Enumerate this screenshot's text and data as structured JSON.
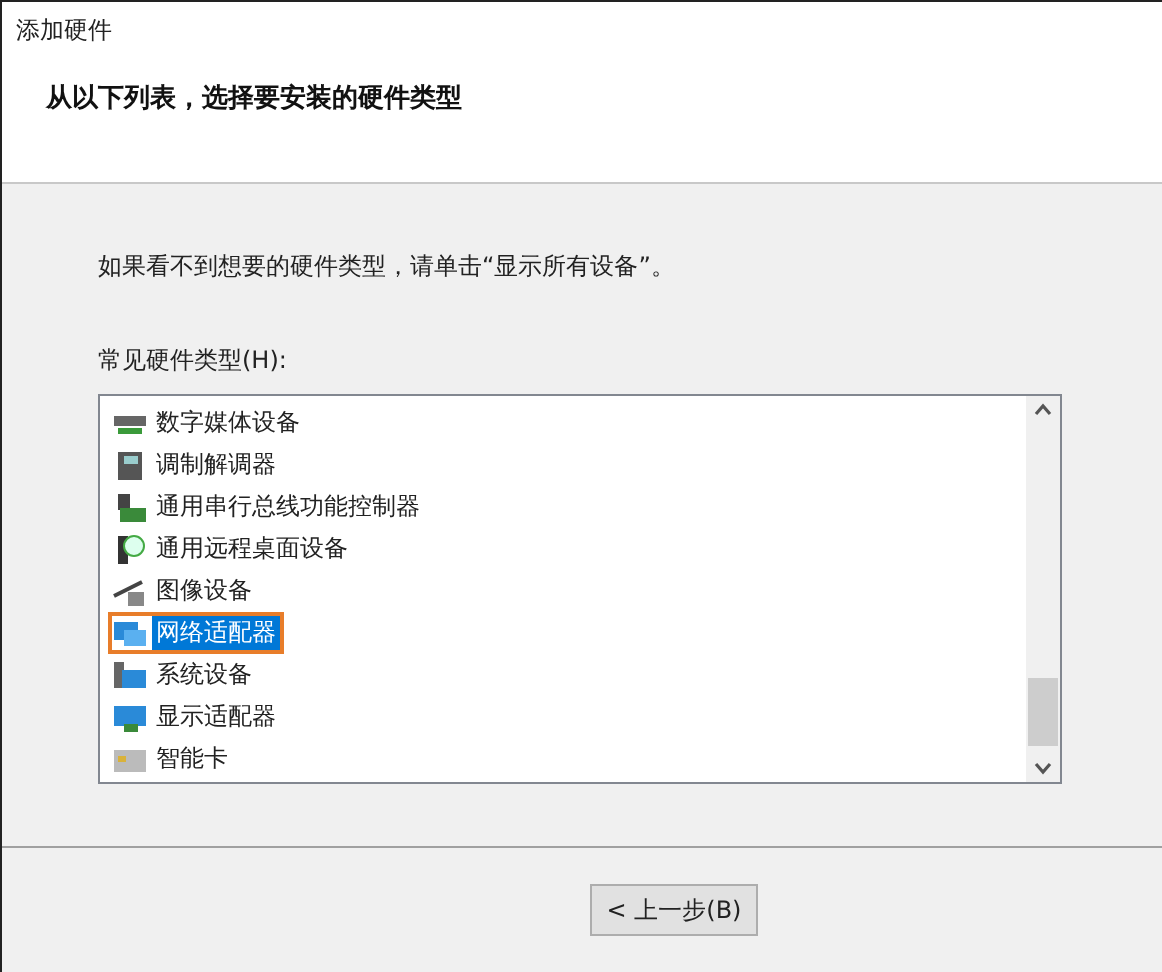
{
  "window": {
    "title": "添加硬件"
  },
  "header": {
    "heading": "从以下列表，选择要安装的硬件类型"
  },
  "hint": "如果看不到想要的硬件类型，请单击“显示所有设备”。",
  "list_label": "常见硬件类型(H):",
  "items": [
    {
      "label": "数字媒体设备",
      "kind": "media",
      "selected": false
    },
    {
      "label": "调制解调器",
      "kind": "modem",
      "selected": false
    },
    {
      "label": "通用串行总线功能控制器",
      "kind": "usb",
      "selected": false
    },
    {
      "label": "通用远程桌面设备",
      "kind": "remote",
      "selected": false
    },
    {
      "label": "图像设备",
      "kind": "camera",
      "selected": false
    },
    {
      "label": "网络适配器",
      "kind": "network",
      "selected": true
    },
    {
      "label": "系统设备",
      "kind": "system",
      "selected": false
    },
    {
      "label": "显示适配器",
      "kind": "display",
      "selected": false
    },
    {
      "label": "智能卡",
      "kind": "card",
      "selected": false
    }
  ],
  "buttons": [
    {
      "label": "< 上一步(B)"
    }
  ]
}
